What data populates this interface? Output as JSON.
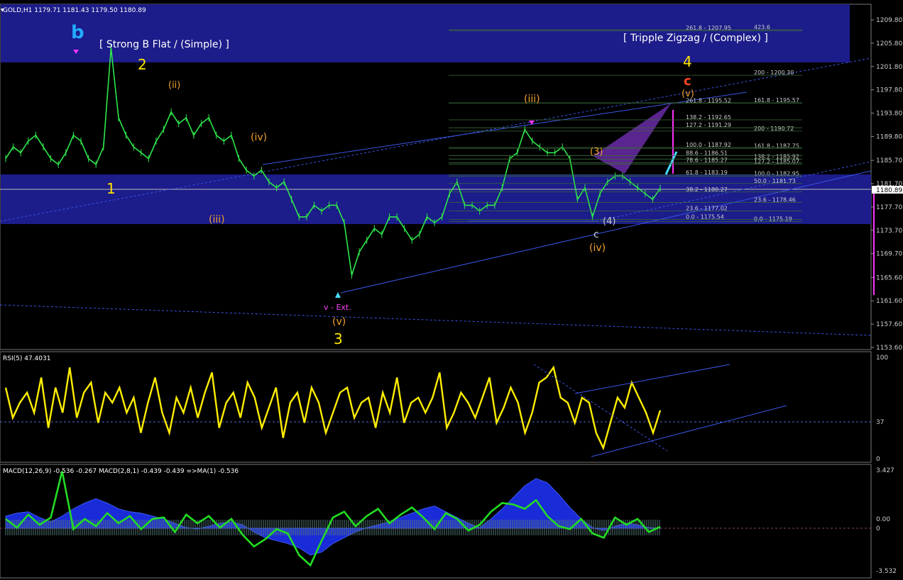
{
  "header": {
    "symbol_line": "GOLD,H1  1179.71 1181.43 1179.50 1180.89",
    "menu_glyph": "▼"
  },
  "panes": {
    "rsi": {
      "label": "RSI(5) 47.4031",
      "levels": [
        "100",
        "37",
        "0"
      ]
    },
    "macd": {
      "label": "MACD(12,26,9) -0.536 -0.267  MACD(2,8,1) -0.439 -0.439  =>MA(1) -0.536",
      "levels": [
        "3.427",
        "0.00",
        "0",
        "-3.532"
      ]
    }
  },
  "price_axis": {
    "ticks": [
      "1209.80",
      "1205.80",
      "1201.80",
      "1197.80",
      "1193.80",
      "1189.80",
      "1185.70",
      "1181.70",
      "1177.70",
      "1173.70",
      "1169.70",
      "1165.60",
      "1161.60",
      "1157.60",
      "1153.60"
    ],
    "current": "1180.89"
  },
  "annotations": {
    "pattern_left": "[ Strong B Flat / (Simple) ]",
    "pattern_right": "[ Tripple Zigzag / (Complex) ]",
    "wave_b_big": "b",
    "wave_1": "1",
    "wave_2": "2",
    "wave_3": "3",
    "wave_4": "4",
    "v_ext": "v - Ext.",
    "wave_v_paren": "(v)",
    "wave_iii_paren": "(iii)",
    "wave_iv_paren": "(iv)",
    "wave_iv_paren_top": "(iv)",
    "wave_ii_paren": "(ii)",
    "wave_c_top": "c",
    "wave_v_top": "(v)",
    "wave_3_paren": "(3)",
    "wave_4_paren": "(4)",
    "wave_iv_lower": "(iv)",
    "c_lower": "c"
  },
  "fib_levels": [
    {
      "text": "423.6",
      "price": 1208.1
    },
    {
      "text": "261.8 - 1207.95",
      "price": 1207.95
    },
    {
      "text": "200 - 1200.30",
      "price": 1200.3
    },
    {
      "text": "261.8 - 1195.52",
      "price": 1195.52
    },
    {
      "text": "161.8 - 1195.57",
      "price": 1195.57
    },
    {
      "text": "138.2 - 1192.65",
      "price": 1192.65
    },
    {
      "text": "200 - 1190.72",
      "price": 1190.72
    },
    {
      "text": "127.2 - 1191.29",
      "price": 1191.29
    },
    {
      "text": "161.8 - 1187.75",
      "price": 1187.75
    },
    {
      "text": "100.0 - 1187.92",
      "price": 1187.92
    },
    {
      "text": "138.2 - 1185.92",
      "price": 1185.92
    },
    {
      "text": "88.6 - 1186.51",
      "price": 1186.51
    },
    {
      "text": "127.2 - 1185.07",
      "price": 1185.07
    },
    {
      "text": "78.6 - 1185.27",
      "price": 1185.27
    },
    {
      "text": "100.0 - 1182.95",
      "price": 1182.95
    },
    {
      "text": "61.8 - 1183.19",
      "price": 1183.19
    },
    {
      "text": "50.0 - 1181.73",
      "price": 1181.73
    },
    {
      "text": "38.2 - 1180.27",
      "price": 1180.27
    },
    {
      "text": "23.6 - 1178.46",
      "price": 1178.46
    },
    {
      "text": "23.6 - 1177.02",
      "price": 1177.02
    },
    {
      "text": "0.0 - 1175.19",
      "price": 1175.19
    },
    {
      "text": "0.0 - 1175.54",
      "price": 1175.54
    }
  ],
  "colors": {
    "background": "#000000",
    "price_bars": "#2ee84a",
    "zone_fill": "#1c1c8a",
    "trend_line": "#3b55e6",
    "rsi_line": "#ffee00",
    "macd_hist_fill": "#1a2bd8",
    "macd_signal": "#22dd22",
    "axis_text": "#cfcfcf",
    "magenta": "#ff33ff",
    "cyan_arrow": "#44ddff",
    "orange": "#f0a030",
    "red_label": "#ff4422",
    "wave_yellow": "#ffe500",
    "blue_label": "#44aaff"
  },
  "chart_data": [
    {
      "type": "line",
      "title": "GOLD,H1  1179.71 1181.43 1179.50 1180.89",
      "ylim": [
        1153.6,
        1211.0
      ],
      "series": [
        {
          "name": "GOLD,H1",
          "values": [
            1186,
            1188,
            1187,
            1189,
            1190,
            1188,
            1186,
            1185,
            1187,
            1190,
            1189,
            1186,
            1185,
            1188,
            1205,
            1193,
            1190,
            1188,
            1187,
            1186,
            1189,
            1191,
            1194,
            1192,
            1193,
            1190,
            1192,
            1193,
            1190,
            1189,
            1190,
            1186,
            1184,
            1183,
            1184,
            1182,
            1181,
            1182,
            1179,
            1176,
            1176,
            1178,
            1177,
            1178,
            1178,
            1175,
            1166,
            1170,
            1172,
            1174,
            1173,
            1176,
            1176,
            1174,
            1172,
            1173,
            1176,
            1175,
            1176,
            1180,
            1182,
            1178,
            1178,
            1177,
            1178,
            1178,
            1181,
            1186,
            1187,
            1191,
            1189,
            1188,
            1187,
            1187,
            1188,
            1186,
            1179,
            1181,
            1176,
            1180,
            1182,
            1183,
            1183,
            1182,
            1181,
            1180,
            1179,
            1180.9
          ]
        }
      ]
    },
    {
      "type": "line",
      "title": "RSI(5) 47.4031",
      "ylim": [
        0,
        100
      ],
      "series": [
        {
          "name": "RSI(5)",
          "values": [
            70,
            40,
            55,
            65,
            45,
            80,
            30,
            70,
            45,
            90,
            40,
            65,
            75,
            35,
            65,
            55,
            70,
            45,
            60,
            25,
            55,
            80,
            45,
            25,
            60,
            45,
            70,
            40,
            65,
            85,
            30,
            55,
            65,
            40,
            75,
            60,
            30,
            50,
            70,
            20,
            55,
            65,
            35,
            70,
            55,
            25,
            45,
            65,
            70,
            40,
            55,
            60,
            30,
            65,
            45,
            80,
            35,
            55,
            60,
            45,
            60,
            85,
            30,
            45,
            65,
            55,
            40,
            60,
            80,
            35,
            50,
            70,
            55,
            25,
            45,
            75,
            80,
            90,
            60,
            55,
            35,
            60,
            55,
            25,
            10,
            35,
            60,
            50,
            75,
            60,
            45,
            25,
            47.4
          ]
        }
      ]
    },
    {
      "type": "line",
      "title": "MACD(12,26,9) -0.536 -0.267  MACD(2,8,1) -0.439 -0.439  =>MA(1) -0.536",
      "ylim": [
        -3.532,
        3.427
      ],
      "series": [
        {
          "name": "MACD(12,26,9)",
          "values": [
            0.3,
            0.5,
            0.6,
            0.2,
            -0.1,
            0.3,
            0.8,
            1.2,
            1.5,
            1.2,
            0.8,
            0.6,
            0.5,
            0.3,
            0.1,
            -0.2,
            -0.5,
            -0.6,
            -0.4,
            -0.2,
            -0.1,
            -0.3,
            -0.8,
            -1.2,
            -1.4,
            -1.6,
            -1.9,
            -2.4,
            -2.2,
            -1.6,
            -1.2,
            -0.8,
            -0.5,
            -0.3,
            -0.1,
            0.2,
            0.5,
            0.8,
            1.0,
            0.6,
            0.2,
            -0.2,
            -0.5,
            0.1,
            0.8,
            1.6,
            2.4,
            2.9,
            2.6,
            1.8,
            0.9,
            0.1,
            -0.5,
            -0.7,
            -0.4,
            -0.2,
            -0.3,
            -0.5,
            -0.536
          ]
        },
        {
          "name": "MACD(2,8,1)",
          "values": [
            0.1,
            -0.5,
            0.4,
            -0.3,
            0.2,
            3.4,
            -0.6,
            0.1,
            -0.4,
            0.5,
            -0.2,
            0.3,
            -0.6,
            0.1,
            0.2,
            -0.8,
            0.4,
            -0.2,
            0.3,
            -0.5,
            0.1,
            -1.0,
            -1.8,
            -1.3,
            -0.6,
            -0.9,
            -2.4,
            -3.1,
            -1.4,
            0.2,
            0.6,
            -0.4,
            0.3,
            0.8,
            -0.2,
            0.4,
            0.9,
            0.2,
            -0.6,
            0.5,
            0.1,
            -0.7,
            -0.3,
            0.6,
            1.2,
            1.1,
            0.8,
            1.4,
            0.3,
            -0.4,
            -0.6,
            0.1,
            -0.9,
            -1.2,
            0.2,
            -0.3,
            0.1,
            -0.8,
            -0.439
          ]
        }
      ]
    }
  ]
}
